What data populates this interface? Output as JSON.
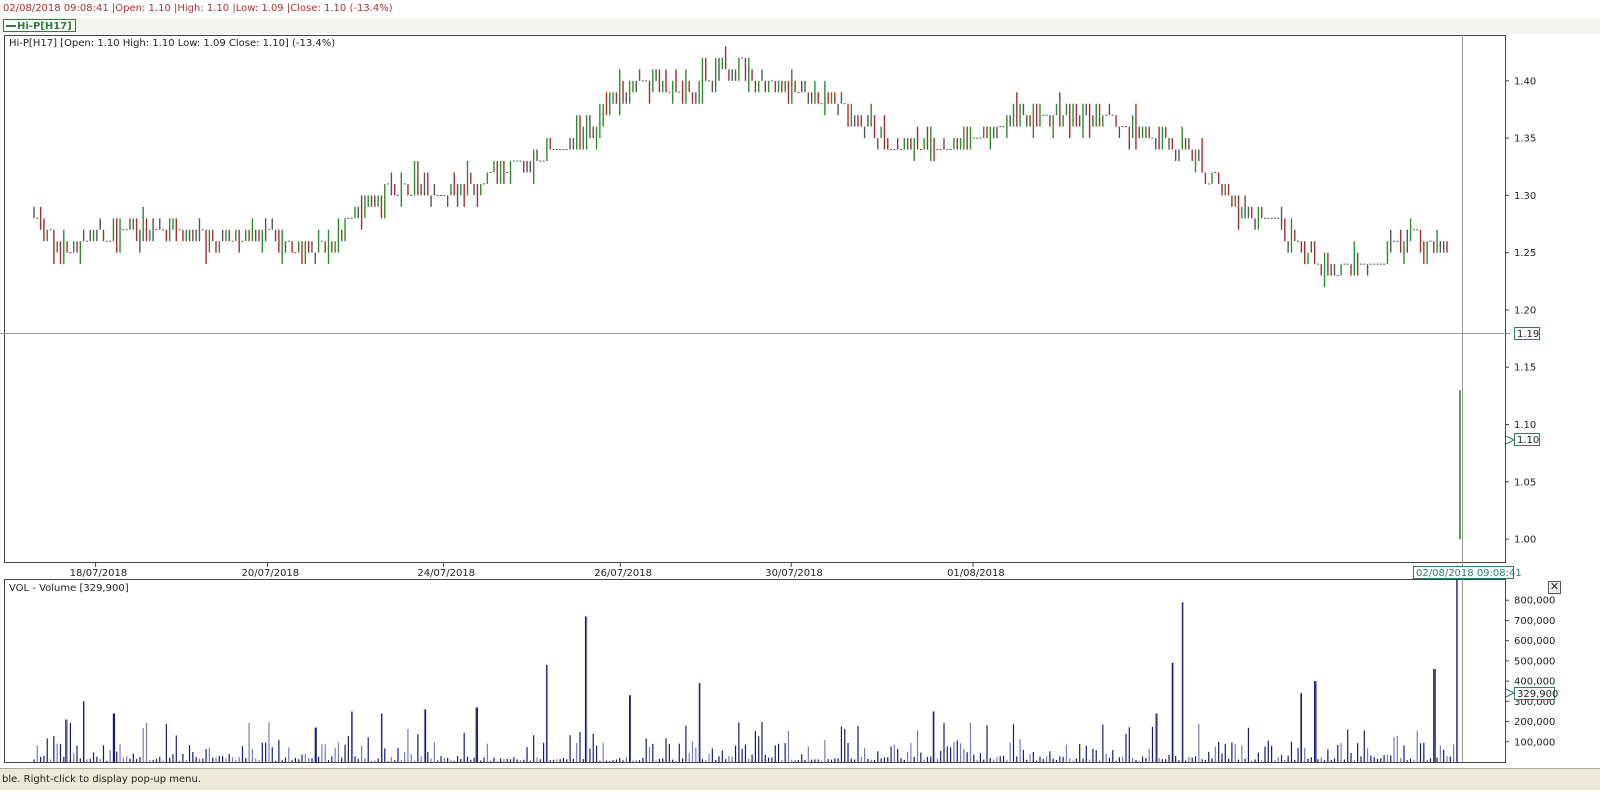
{
  "header": {
    "timestamp": "02/08/2018 09:08:41",
    "ohlc_text": "|Open: 1.10 |High: 1.10 |Low: 1.09 |Close: 1.10 (-13.4%)"
  },
  "series_tab": {
    "label": "Hi-P[H17]",
    "color": "#2e7d32"
  },
  "price_panel": {
    "info": "Hi-P[H17] [Open: 1.10  High: 1.10  Low: 1.09  Close: 1.10] (-13.4%)",
    "crosshair_price": "1.19",
    "last_price": "1.10",
    "crosshair_date": "02/08/2018 09:08:41"
  },
  "volume_panel": {
    "info": "VOL - Volume [329,900]",
    "last_volume": "329,900",
    "close_icon": "close-icon"
  },
  "status_bar": {
    "text": "ble. Right-click to display pop-up menu."
  },
  "chart_data": [
    {
      "type": "candlestick",
      "title": "Hi-P[H17]",
      "ylim": [
        0.98,
        1.44
      ],
      "y_ticks": [
        "1.00",
        "1.05",
        "1.10",
        "1.15",
        "1.20",
        "1.25",
        "1.30",
        "1.35",
        "1.40"
      ],
      "x_tick_labels": [
        "18/07/2018",
        "20/07/2018",
        "24/07/2018",
        "26/07/2018",
        "30/07/2018",
        "01/08/2018"
      ],
      "colors": {
        "up": "#2e8b2e",
        "down": "#a03030",
        "flat": "#555555"
      },
      "control_points": [
        {
          "x": 0.0,
          "y": 1.28
        },
        {
          "x": 2.3,
          "y": 1.25
        },
        {
          "x": 6.0,
          "y": 1.26
        },
        {
          "x": 10.0,
          "y": 1.27
        },
        {
          "x": 15.0,
          "y": 1.27
        },
        {
          "x": 18.0,
          "y": 1.26
        },
        {
          "x": 23.0,
          "y": 1.27
        },
        {
          "x": 26.0,
          "y": 1.25
        },
        {
          "x": 30.0,
          "y": 1.26
        },
        {
          "x": 33.0,
          "y": 1.29
        },
        {
          "x": 37.0,
          "y": 1.31
        },
        {
          "x": 42.0,
          "y": 1.3
        },
        {
          "x": 46.0,
          "y": 1.32
        },
        {
          "x": 50.0,
          "y": 1.33
        },
        {
          "x": 55.0,
          "y": 1.35
        },
        {
          "x": 59.0,
          "y": 1.39
        },
        {
          "x": 62.0,
          "y": 1.4
        },
        {
          "x": 66.0,
          "y": 1.39
        },
        {
          "x": 70.0,
          "y": 1.41
        },
        {
          "x": 73.0,
          "y": 1.4
        },
        {
          "x": 77.0,
          "y": 1.39
        },
        {
          "x": 82.0,
          "y": 1.37
        },
        {
          "x": 86.0,
          "y": 1.35
        },
        {
          "x": 91.0,
          "y": 1.34
        },
        {
          "x": 95.0,
          "y": 1.35
        },
        {
          "x": 99.0,
          "y": 1.37
        },
        {
          "x": 103.0,
          "y": 1.37
        },
        {
          "x": 106.0,
          "y": 1.37
        },
        {
          "x": 110.0,
          "y": 1.36
        },
        {
          "x": 114.0,
          "y": 1.35
        },
        {
          "x": 117.0,
          "y": 1.33
        },
        {
          "x": 121.0,
          "y": 1.29
        },
        {
          "x": 125.0,
          "y": 1.28
        },
        {
          "x": 128.0,
          "y": 1.25
        },
        {
          "x": 131.0,
          "y": 1.23
        },
        {
          "x": 134.0,
          "y": 1.24
        },
        {
          "x": 137.0,
          "y": 1.26
        },
        {
          "x": 142.0,
          "y": 1.26
        },
        {
          "x": 143.5,
          "y": 1.1
        }
      ]
    },
    {
      "type": "bar",
      "title": "VOL - Volume [329,900]",
      "ylim": [
        0,
        900000
      ],
      "y_ticks": [
        "100,000",
        "200,000",
        "300,000",
        "400,000",
        "500,000",
        "600,000",
        "700,000",
        "800,000"
      ],
      "color": "#1a1a6e",
      "spikes": [
        {
          "x": 3.2,
          "v": 210000
        },
        {
          "x": 5.0,
          "v": 300000
        },
        {
          "x": 8.1,
          "v": 240000
        },
        {
          "x": 28.4,
          "v": 170000
        },
        {
          "x": 32.0,
          "v": 250000
        },
        {
          "x": 35.0,
          "v": 240000
        },
        {
          "x": 39.4,
          "v": 260000
        },
        {
          "x": 44.5,
          "v": 270000
        },
        {
          "x": 51.6,
          "v": 480000
        },
        {
          "x": 55.5,
          "v": 720000
        },
        {
          "x": 60.0,
          "v": 330000
        },
        {
          "x": 67.0,
          "v": 390000
        },
        {
          "x": 90.5,
          "v": 250000
        },
        {
          "x": 113.0,
          "v": 240000
        },
        {
          "x": 114.6,
          "v": 490000
        },
        {
          "x": 115.6,
          "v": 790000
        },
        {
          "x": 127.5,
          "v": 340000
        },
        {
          "x": 129.0,
          "v": 400000
        },
        {
          "x": 141.0,
          "v": 460000
        },
        {
          "x": 143.2,
          "v": 920000
        }
      ]
    }
  ]
}
